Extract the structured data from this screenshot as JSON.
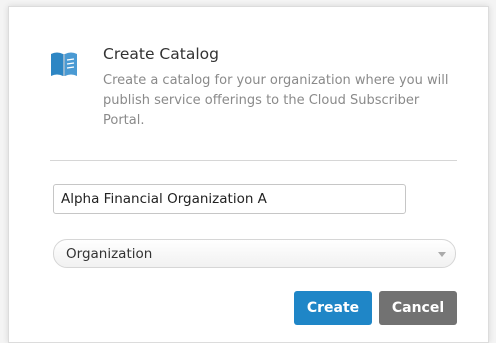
{
  "dialog": {
    "title": "Create Catalog",
    "description": "Create a catalog for your organization where you will publish service offerings to the Cloud Subscriber Portal.",
    "icon": "catalog-book-icon"
  },
  "form": {
    "name_value": "Alpha Financial Organization A",
    "type_selected": "Organization"
  },
  "buttons": {
    "create_label": "Create",
    "cancel_label": "Cancel"
  },
  "colors": {
    "primary": "#1f86c7",
    "secondary": "#727272",
    "icon": "#2d86c4"
  }
}
